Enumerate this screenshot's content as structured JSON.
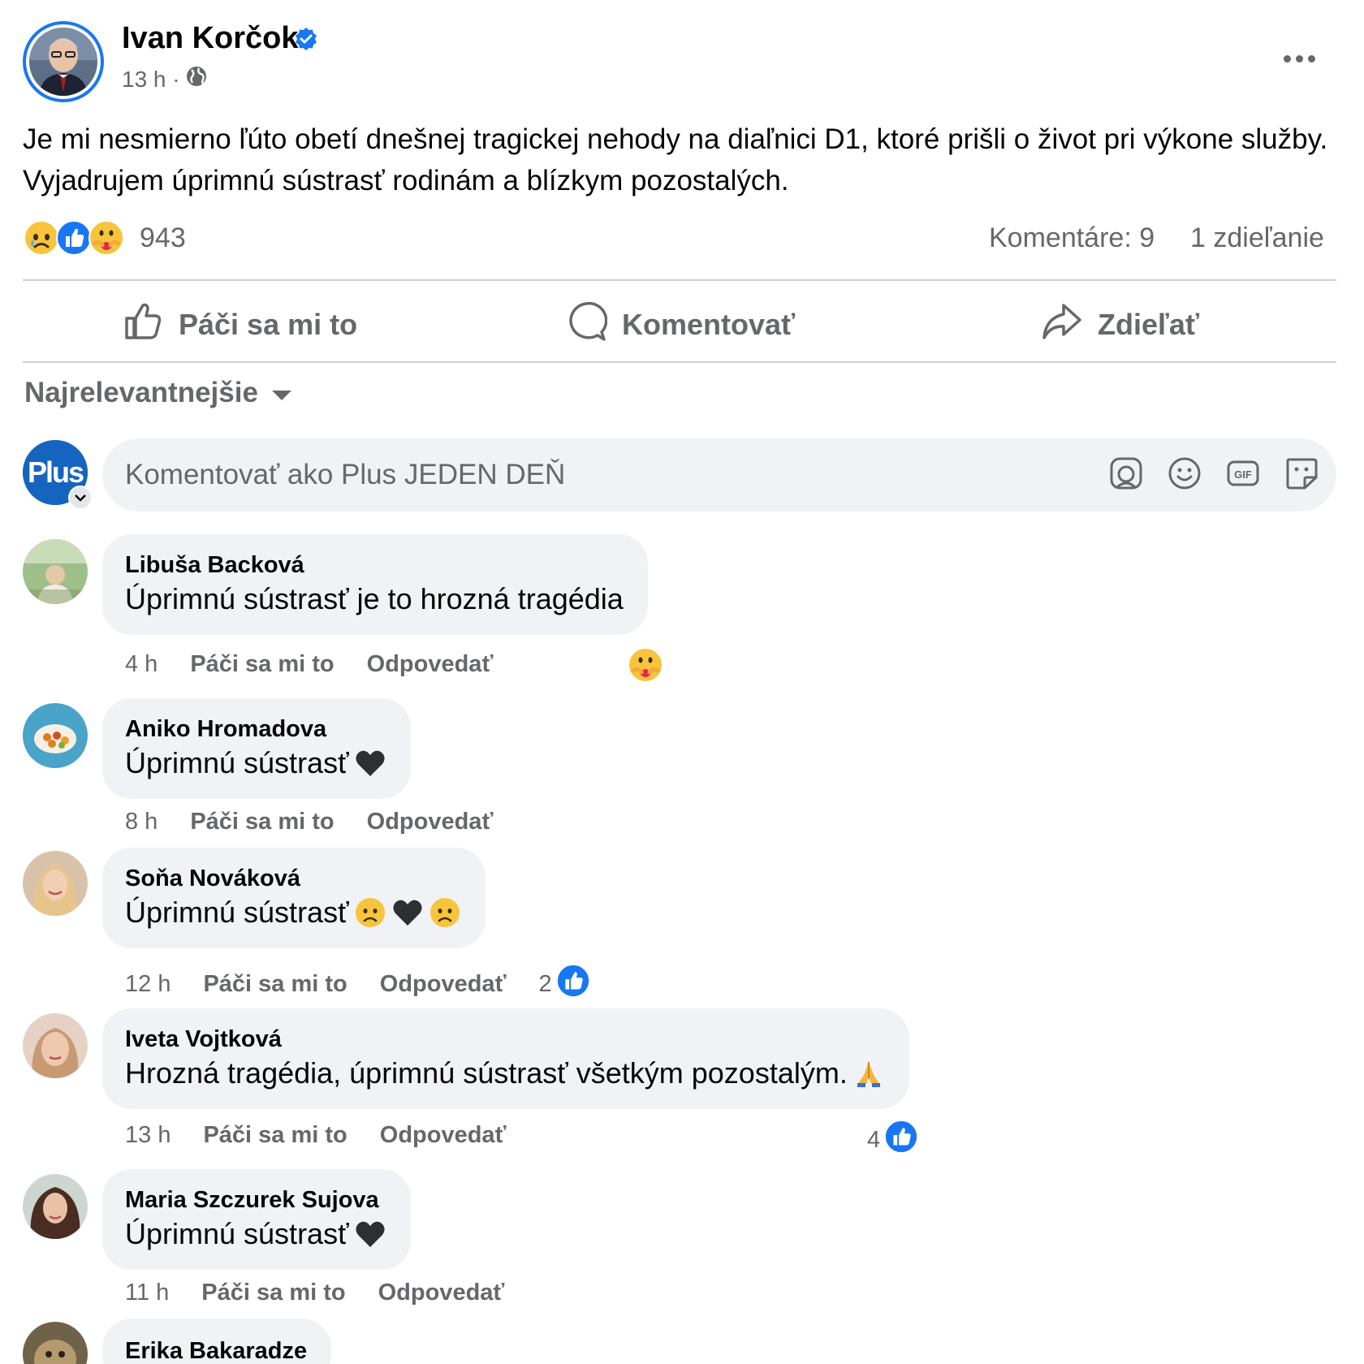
{
  "post": {
    "author": "Ivan Korčok",
    "time": "13 h ·",
    "privacy_icon": "globe-icon",
    "text": "Je mi nesmierno ľúto obetí dnešnej tragickej nehody na diaľnici D1, ktoré prišli o život pri výkone služby. Vyjadrujem úprimnú sústrasť rodinám a blízkym pozostalých.",
    "reactions": {
      "icons": [
        "sad-reaction-icon",
        "like-reaction-icon",
        "care-reaction-icon"
      ],
      "count": "943"
    },
    "comments_count": "Komentáre: 9",
    "shares_count": "1 zdieľanie"
  },
  "actions": {
    "like": "Páči sa mi to",
    "comment": "Komentovať",
    "share": "Zdieľať"
  },
  "sort": {
    "label": "Najrelevantnejšie"
  },
  "composer": {
    "avatar_text": "Plus",
    "placeholder": "Komentovať ako Plus JEDEN DEŇ"
  },
  "comments": [
    {
      "name": "Libuša Backová",
      "text": "Úprimnú sústrasť je to hrozná tragédia",
      "emoji": "",
      "time": "4 h",
      "like": "Páči sa mi to",
      "reply": "Odpovedať",
      "reaction_count": "",
      "reaction_icon": "care-reaction-icon",
      "avatar_color": "#8aa87a"
    },
    {
      "name": "Aniko Hromadova",
      "text": "Úprimnú sústrasť",
      "emoji": "black-heart-icon",
      "time": "8 h",
      "like": "Páči sa mi to",
      "reply": "Odpovedať",
      "reaction_count": "",
      "reaction_icon": "",
      "avatar_color": "#4aa3c8"
    },
    {
      "name": "Soňa Nováková",
      "text": "Úprimnú sústrasť",
      "emoji": "sad-black-heart-sad",
      "time": "12 h",
      "like": "Páči sa mi to",
      "reply": "Odpovedať",
      "reaction_count": "2",
      "reaction_icon": "like-reaction-icon",
      "avatar_color": "#d8b59a"
    },
    {
      "name": "Iveta Vojtková",
      "text": "Hrozná tragédia, úprimnú sústrasť všetkým pozostalým.",
      "emoji": "folded-hands-icon",
      "time": "13 h",
      "like": "Páči sa mi to",
      "reply": "Odpovedať",
      "reaction_count": "4",
      "reaction_icon": "like-reaction-icon",
      "avatar_color": "#d9a58d"
    },
    {
      "name": "Maria Szczurek Sujova",
      "text": "Úprimnú sústrasť",
      "emoji": "black-heart-icon",
      "time": "11 h",
      "like": "Páči sa mi to",
      "reply": "Odpovedať",
      "reaction_count": "",
      "reaction_icon": "",
      "avatar_color": "#5a3a2e"
    },
    {
      "name": "Erika Bakaradze",
      "text": "",
      "emoji": "",
      "time": "",
      "like": "",
      "reply": "",
      "reaction_count": "",
      "reaction_icon": "",
      "avatar_color": "#8a7a5a"
    }
  ],
  "colors": {
    "accent": "#1877f2",
    "secondary_text": "#65676b",
    "bubble": "#f0f2f5"
  }
}
